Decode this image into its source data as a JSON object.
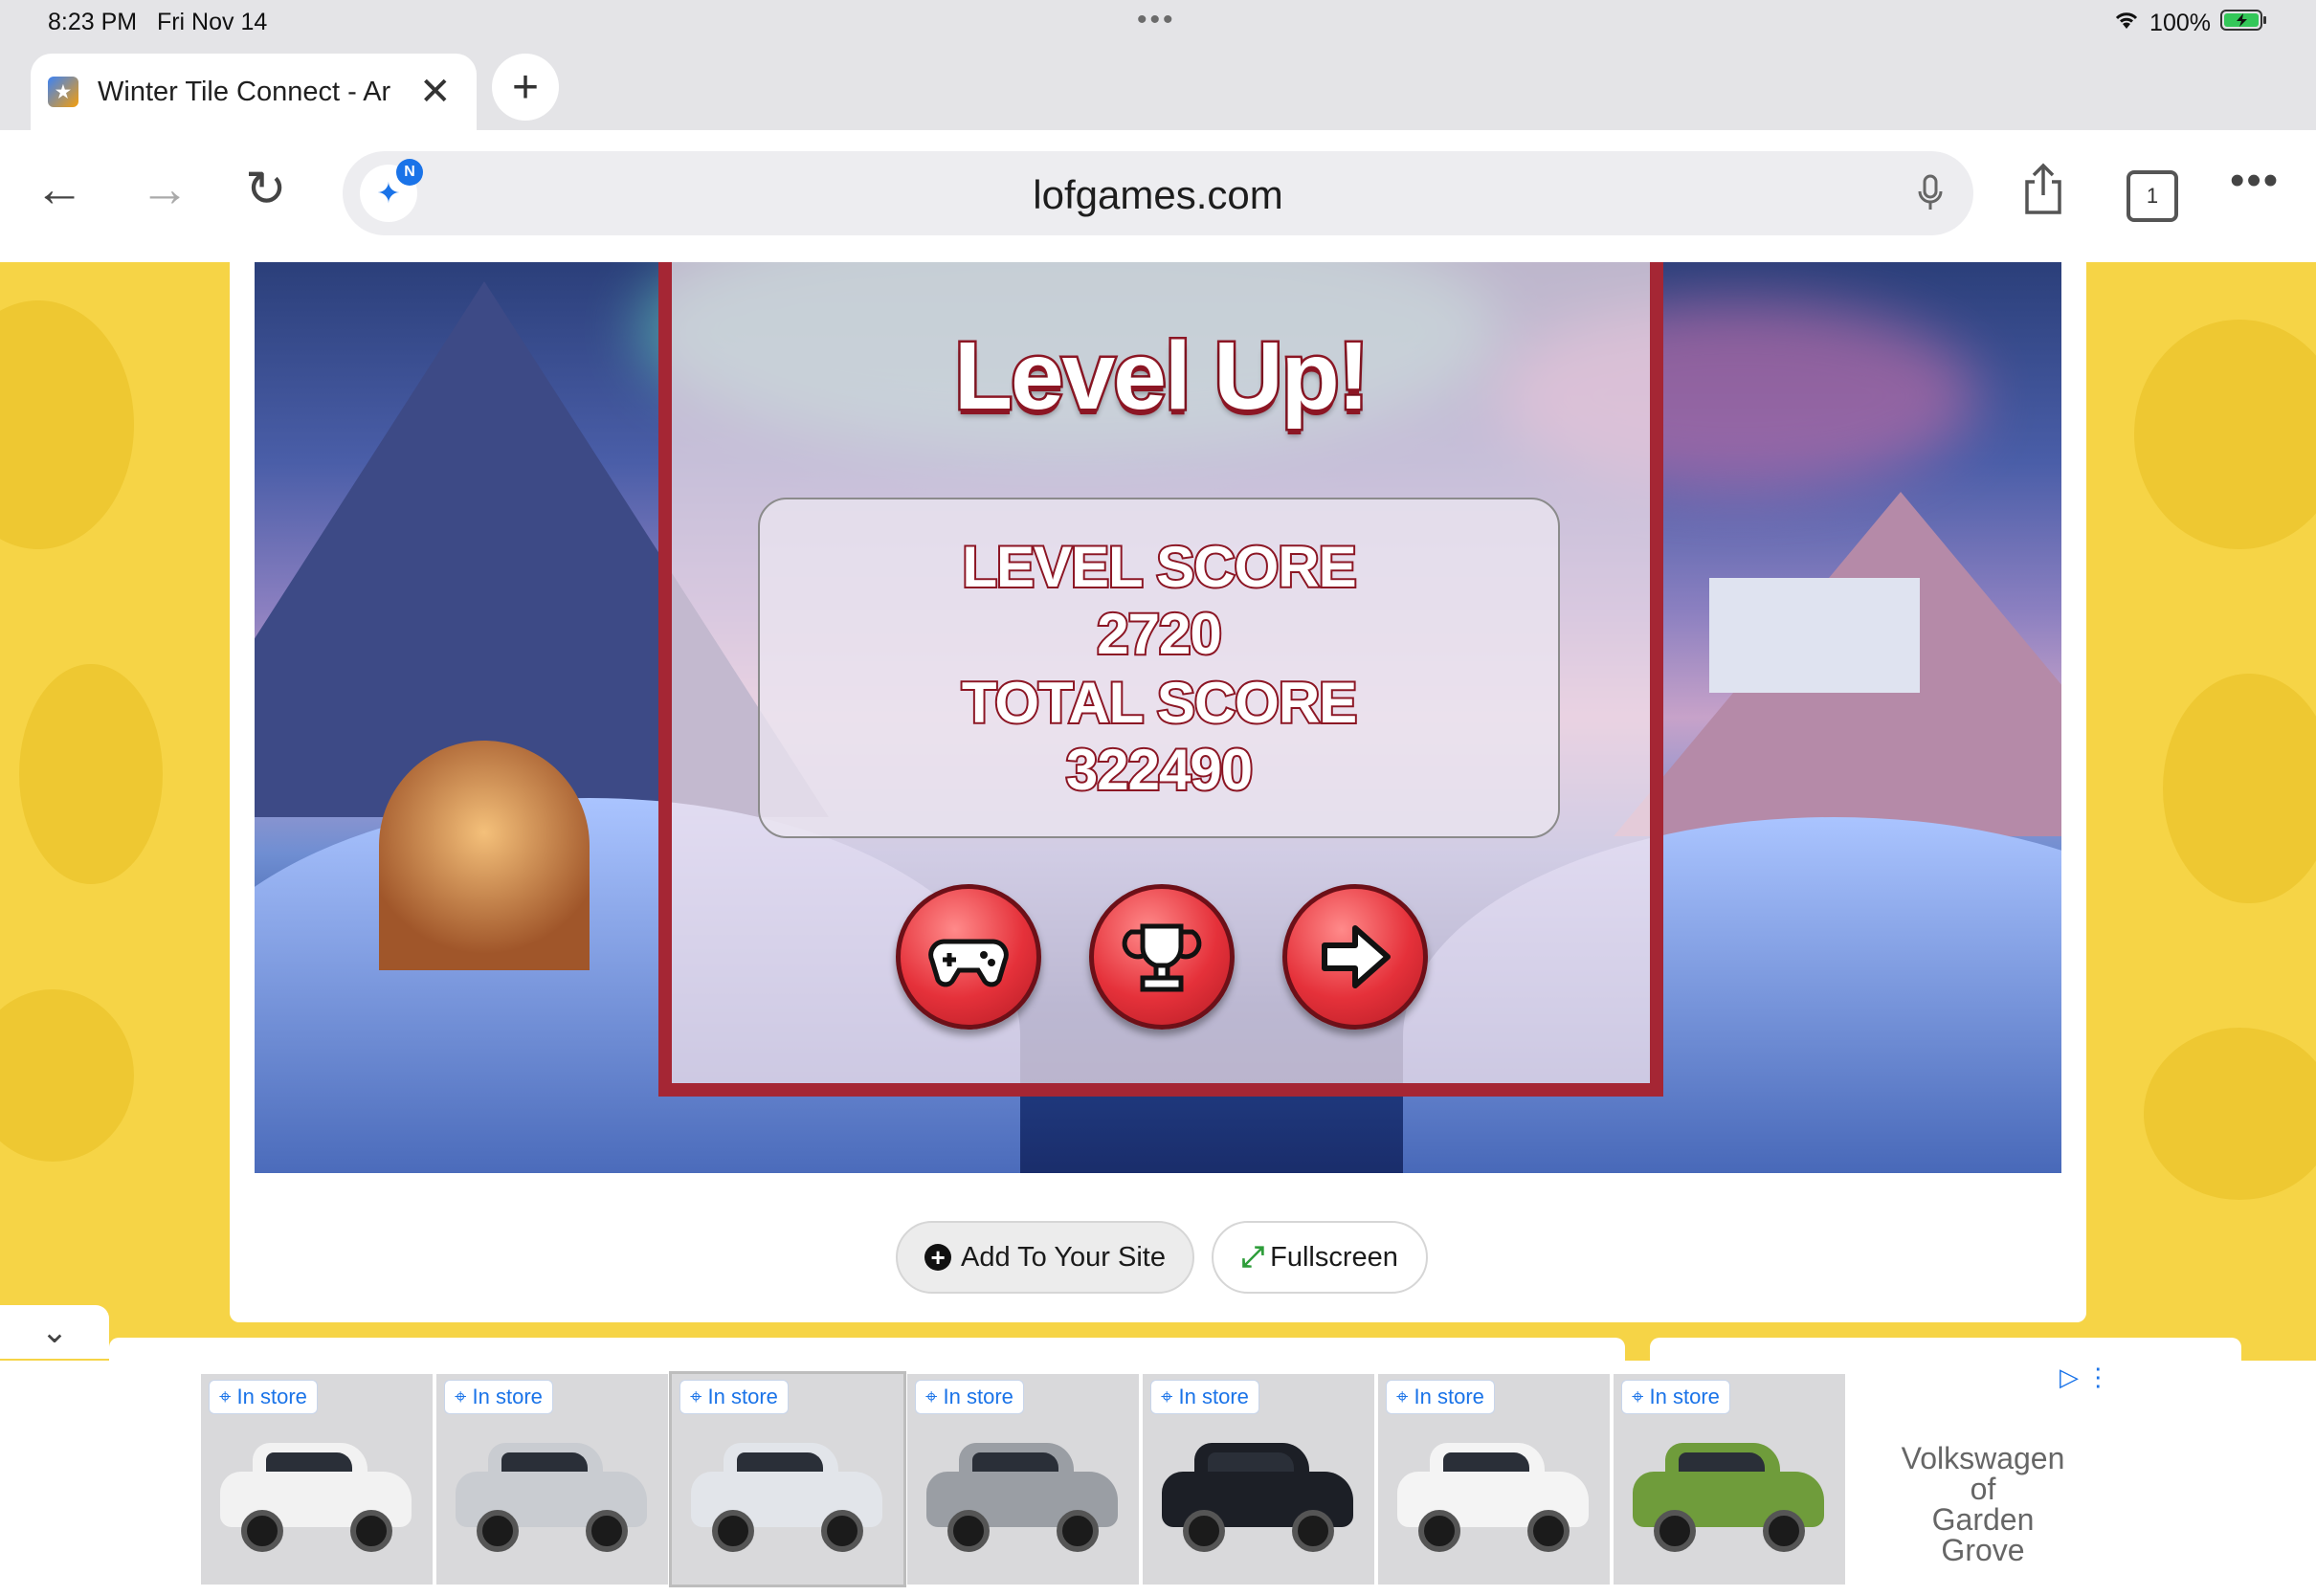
{
  "status_bar": {
    "time": "8:23 PM",
    "date": "Fri Nov 14",
    "battery": "100%"
  },
  "browser": {
    "tab_title": "Winter Tile Connect - Ar",
    "url": "lofgames.com",
    "tab_count": "1",
    "ai_badge": "N"
  },
  "game": {
    "title": "Level Up!",
    "level_score_label": "LEVEL SCORE",
    "level_score": "2720",
    "total_score_label": "TOTAL SCORE",
    "total_score": "322490"
  },
  "site_buttons": {
    "add_label": "Add To Your Site",
    "fullscreen_label": "Fullscreen"
  },
  "ad": {
    "pill_label": "In store",
    "advertiser_line1": "Volkswagen of",
    "advertiser_line2": "Garden Grove",
    "cars": [
      {
        "color": "#f2f2f2"
      },
      {
        "color": "#c9ccd1"
      },
      {
        "color": "#e2e5ea"
      },
      {
        "color": "#9a9ea4"
      },
      {
        "color": "#1c1f26"
      },
      {
        "color": "#f4f4f4"
      },
      {
        "color": "#6f9c3b"
      }
    ]
  }
}
